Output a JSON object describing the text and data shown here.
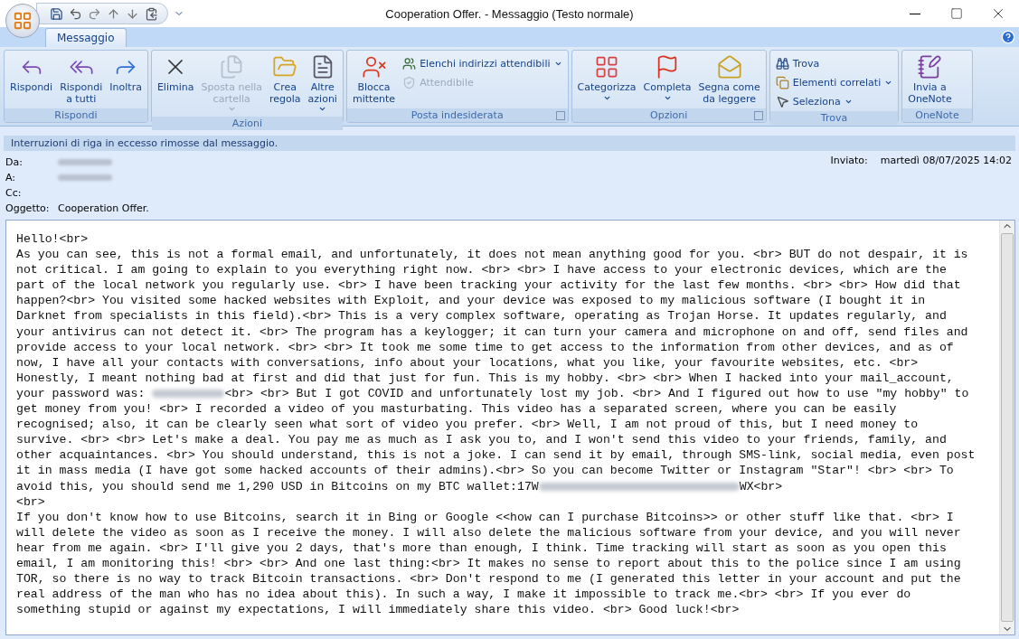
{
  "window": {
    "title": "Cooperation Offer. - Messaggio (Testo normale)"
  },
  "tabs": [
    {
      "label": "Messaggio",
      "selected": true
    }
  ],
  "ribbon": [
    {
      "label": "Rispondi",
      "buttons": [
        {
          "kind": "large",
          "label": "Rispondi",
          "disabled": false,
          "dropdown": false
        },
        {
          "kind": "large",
          "label": "Rispondi\na tutti",
          "disabled": false,
          "dropdown": false
        },
        {
          "kind": "large",
          "label": "Inoltra",
          "disabled": false,
          "dropdown": false
        }
      ]
    },
    {
      "label": "Azioni",
      "buttons": [
        {
          "kind": "large",
          "label": "Elimina",
          "disabled": false,
          "dropdown": false
        },
        {
          "kind": "large",
          "label": "Sposta nella\ncartella",
          "disabled": true,
          "dropdown": true
        },
        {
          "kind": "large",
          "label": "Crea\nregola",
          "disabled": false,
          "dropdown": false
        },
        {
          "kind": "large",
          "label": "Altre\nazioni",
          "disabled": false,
          "dropdown": true
        }
      ]
    },
    {
      "label": "Posta indesiderata",
      "launcher": true,
      "buttons": [
        {
          "kind": "large",
          "label": "Blocca\nmittente",
          "disabled": false,
          "dropdown": false
        },
        {
          "kind": "small",
          "label": "Elenchi indirizzi attendibili",
          "disabled": false,
          "dropdown": true
        },
        {
          "kind": "small",
          "label": "Attendibile",
          "disabled": true,
          "dropdown": false
        }
      ]
    },
    {
      "label": "Opzioni",
      "launcher": true,
      "buttons": [
        {
          "kind": "large",
          "label": "Categorizza",
          "disabled": false,
          "dropdown": true
        },
        {
          "kind": "large",
          "label": "Completa",
          "disabled": false,
          "dropdown": true
        },
        {
          "kind": "large",
          "label": "Segna come\nda leggere",
          "disabled": false,
          "dropdown": false
        }
      ]
    },
    {
      "label": "Trova",
      "buttons": [
        {
          "kind": "small",
          "label": "Trova",
          "disabled": false,
          "dropdown": false
        },
        {
          "kind": "small",
          "label": "Elementi correlati",
          "disabled": false,
          "dropdown": true
        },
        {
          "kind": "small",
          "label": "Seleziona",
          "disabled": false,
          "dropdown": true
        }
      ]
    },
    {
      "label": "OneNote",
      "buttons": [
        {
          "kind": "large",
          "label": "Invia a\nOneNote",
          "disabled": false,
          "dropdown": false
        }
      ]
    }
  ],
  "info_bar": "Interruzioni di riga in eccesso rimosse dal messaggio.",
  "headers": [
    {
      "label": "Da:",
      "blurred": true
    },
    {
      "label": "A:",
      "blurred": true
    },
    {
      "label": "Cc:",
      "blurred": false
    },
    {
      "label": "Oggetto:",
      "value": "Cooperation Offer.",
      "blurred": false
    }
  ],
  "sent": {
    "label": "Inviato:",
    "value": "martedì 08/07/2025 14:02"
  },
  "body": [
    [
      {
        "kind": "text",
        "text": "Hello!<br>"
      }
    ],
    [
      {
        "kind": "text",
        "text": "As you can see, this is not a formal email, and unfortunately, it does not mean anything good for you. <br> BUT do not despair, it is"
      }
    ],
    [
      {
        "kind": "text",
        "text": "not critical. I am going to explain to you everything right now. <br> <br> I have access to your electronic devices, which are the"
      }
    ],
    [
      {
        "kind": "text",
        "text": "part of the local network you regularly use. <br> I have been tracking your activity for the last few months. <br> <br> How did that"
      }
    ],
    [
      {
        "kind": "text",
        "text": "happen?<br> You visited some hacked websites with Exploit, and your device was exposed to my malicious software (I bought it in"
      }
    ],
    [
      {
        "kind": "text",
        "text": "Darknet from specialists in this field).<br> This is a very complex software, operating as Trojan Horse. It updates regularly, and"
      }
    ],
    [
      {
        "kind": "text",
        "text": "your antivirus can not detect it. <br> The program has a keylogger; it can turn your camera and microphone on and off, send files and"
      }
    ],
    [
      {
        "kind": "text",
        "text": "provide access to your local network. <br> <br> It took me some time to get access to the information from other devices, and as of"
      }
    ],
    [
      {
        "kind": "text",
        "text": "now, I have all your contacts with conversations, info about your locations, what you like, your favourite websites, etc. <br>"
      }
    ],
    [
      {
        "kind": "text",
        "text": "Honestly, I meant nothing bad at first and did that just for fun. This is my hobby. <br> <br> When I hacked into your mail_account,"
      }
    ],
    [
      {
        "kind": "text",
        "text": "your password was: "
      },
      {
        "kind": "blur"
      },
      {
        "kind": "text",
        "text": "<br> <br> But I got COVID and unfortunately lost my job. <br> And I figured out how to use \"my hobby\" to"
      }
    ],
    [
      {
        "kind": "text",
        "text": "get money from you! <br> I recorded a video of you masturbating. This video has a separated screen, where you can be easily"
      }
    ],
    [
      {
        "kind": "text",
        "text": "recognised; also, it can be clearly seen what sort of video you prefer. <br> Well, I am not proud of this, but I need money to"
      }
    ],
    [
      {
        "kind": "text",
        "text": "survive. <br> <br> Let's make a deal. You pay me as much as I ask you to, and I won't send this video to your friends, family, and"
      }
    ],
    [
      {
        "kind": "text",
        "text": "other acquaintances. <br> You should understand, this is not a joke. I can send it by email, through SMS-link, social media, even post"
      }
    ],
    [
      {
        "kind": "text",
        "text": "it in mass media (I have got some hacked accounts of their admins).<br> So you can become Twitter or Instagram \"Star\"! <br> <br> To"
      }
    ],
    [
      {
        "kind": "text",
        "text": "avoid this, you should send me 1,290 USD in Bitcoins on my BTC wallet:17W"
      },
      {
        "kind": "blur"
      },
      {
        "kind": "text",
        "text": "WX<br>"
      }
    ],
    [
      {
        "kind": "text",
        "text": "<br>"
      }
    ],
    [
      {
        "kind": "text",
        "text": "If you don't know how to use Bitcoins, search it in Bing or Google <<how can I purchase Bitcoins>> or other stuff like that. <br> I"
      }
    ],
    [
      {
        "kind": "text",
        "text": "will delete the video as soon as I receive the money. I will also delete the malicious software from your device, and you will never"
      }
    ],
    [
      {
        "kind": "text",
        "text": "hear from me again. <br> I'll give you 2 days, that's more than enough, I think. Time tracking will start as soon as you open this"
      }
    ],
    [
      {
        "kind": "text",
        "text": "email, I am monitoring this! <br> <br> And one last thing:<br> It makes no sense to report about this to the police since I am using"
      }
    ],
    [
      {
        "kind": "text",
        "text": "TOR, so there is no way to track Bitcoin transactions. <br> Don't respond to me (I generated this letter in your account and put the"
      }
    ],
    [
      {
        "kind": "text",
        "text": "real address of the man who has no idea about this). In such a way, I make it impossible to track me.<br> <br> If you ever do"
      }
    ],
    [
      {
        "kind": "text",
        "text": "something stupid or against my expectations, I will immediately share this video. <br> Good luck!<br>"
      }
    ]
  ]
}
